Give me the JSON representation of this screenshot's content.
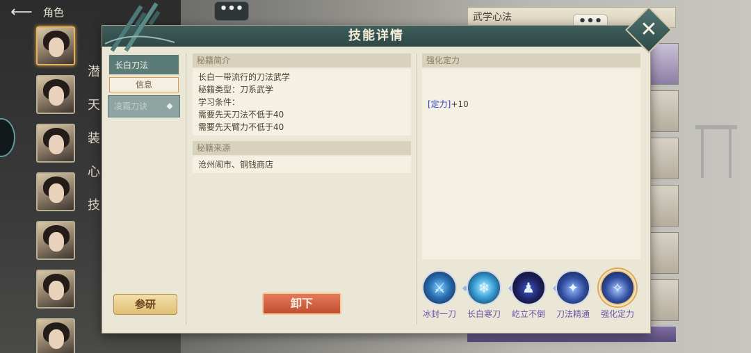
{
  "background": {
    "back_label": "⟵",
    "role_title": "角色",
    "side_tabs": [
      "潜",
      "天",
      "装",
      "心",
      "技"
    ],
    "right_panel_title": "武学心法",
    "bubble_text": "•••",
    "cards": [
      "",
      "",
      "",
      "",
      "",
      "",
      ""
    ]
  },
  "dialog": {
    "title": "技能详情",
    "close_label": "✕",
    "book_list": {
      "selected": "长白刀法",
      "info_tab": "信息",
      "other": "凌霜刀诀",
      "other_icon": "gem-icon"
    },
    "research_button": "参研",
    "intro": {
      "heading": "秘籍简介",
      "lines": [
        "长白一带流行的刀法武学",
        "秘籍类型：刀系武学",
        "学习条件：",
        "需要先天刀法不低于40",
        "需要先天臂力不低于40"
      ]
    },
    "source": {
      "heading": "秘籍来源",
      "text": "沧州闹市、铜钱商店"
    },
    "unequip_button": "卸下",
    "enhance": {
      "heading": "强化定力",
      "stat_key": "[定力]",
      "stat_value": "+10"
    },
    "skills": [
      {
        "name": "冰封一刀",
        "icon": "ice-blade-icon",
        "glyph": "⚔"
      },
      {
        "name": "长白寒刀",
        "icon": "frost-crystal-icon",
        "glyph": "❄"
      },
      {
        "name": "屹立不倒",
        "icon": "standing-figure-icon",
        "glyph": "♟"
      },
      {
        "name": "刀法精通",
        "icon": "mastery-figure-icon",
        "glyph": "✦"
      },
      {
        "name": "强化定力",
        "icon": "focus-figure-icon",
        "glyph": "✧"
      }
    ],
    "colors": {
      "header": "#3e5d5b",
      "stat_key": "#2b3fc9",
      "skill_label": "#6b4fa8",
      "selected_ring": "#e2a84d"
    }
  }
}
